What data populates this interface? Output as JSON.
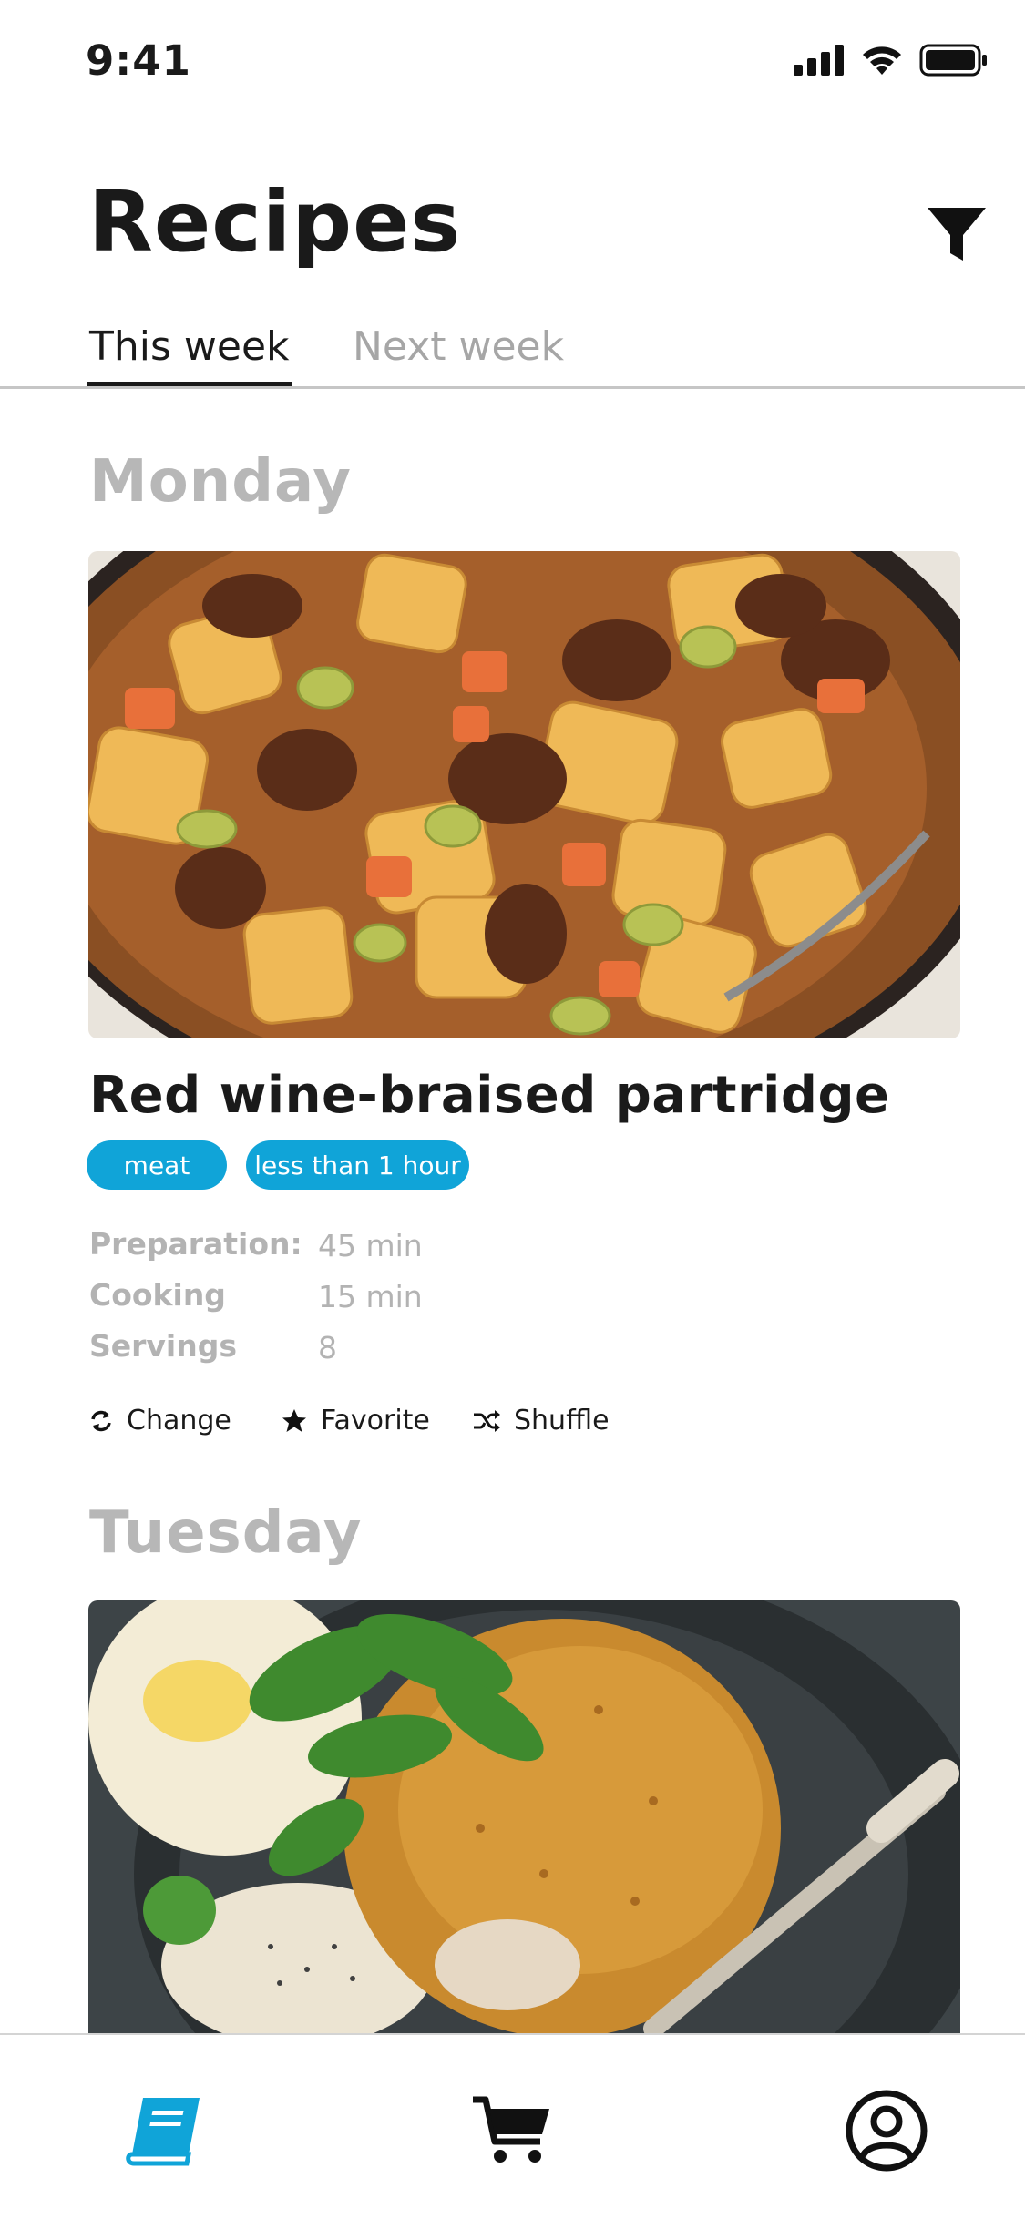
{
  "status_bar": {
    "time": "9:41"
  },
  "header": {
    "title": "Recipes"
  },
  "tabs": [
    {
      "label": "This week",
      "active": true
    },
    {
      "label": "Next week",
      "active": false
    }
  ],
  "days": [
    {
      "day": "Monday",
      "recipe": {
        "name": "Red wine-braised partridge",
        "tags": [
          "meat",
          "less than 1 hour"
        ],
        "info": [
          {
            "label": "Preparation:",
            "value": "45 min"
          },
          {
            "label": "Cooking",
            "value": "15 min"
          },
          {
            "label": "Servings",
            "value": "8"
          }
        ]
      }
    },
    {
      "day": "Tuesday"
    }
  ],
  "actions": {
    "change": "Change",
    "favorite": "Favorite",
    "shuffle": "Shuffle"
  },
  "colors": {
    "accent": "#10a4d8",
    "text": "#1a1a1a",
    "muted": "#b3b3b3"
  },
  "bottom_nav": [
    "recipe-book-icon",
    "cart-icon",
    "profile-icon"
  ]
}
